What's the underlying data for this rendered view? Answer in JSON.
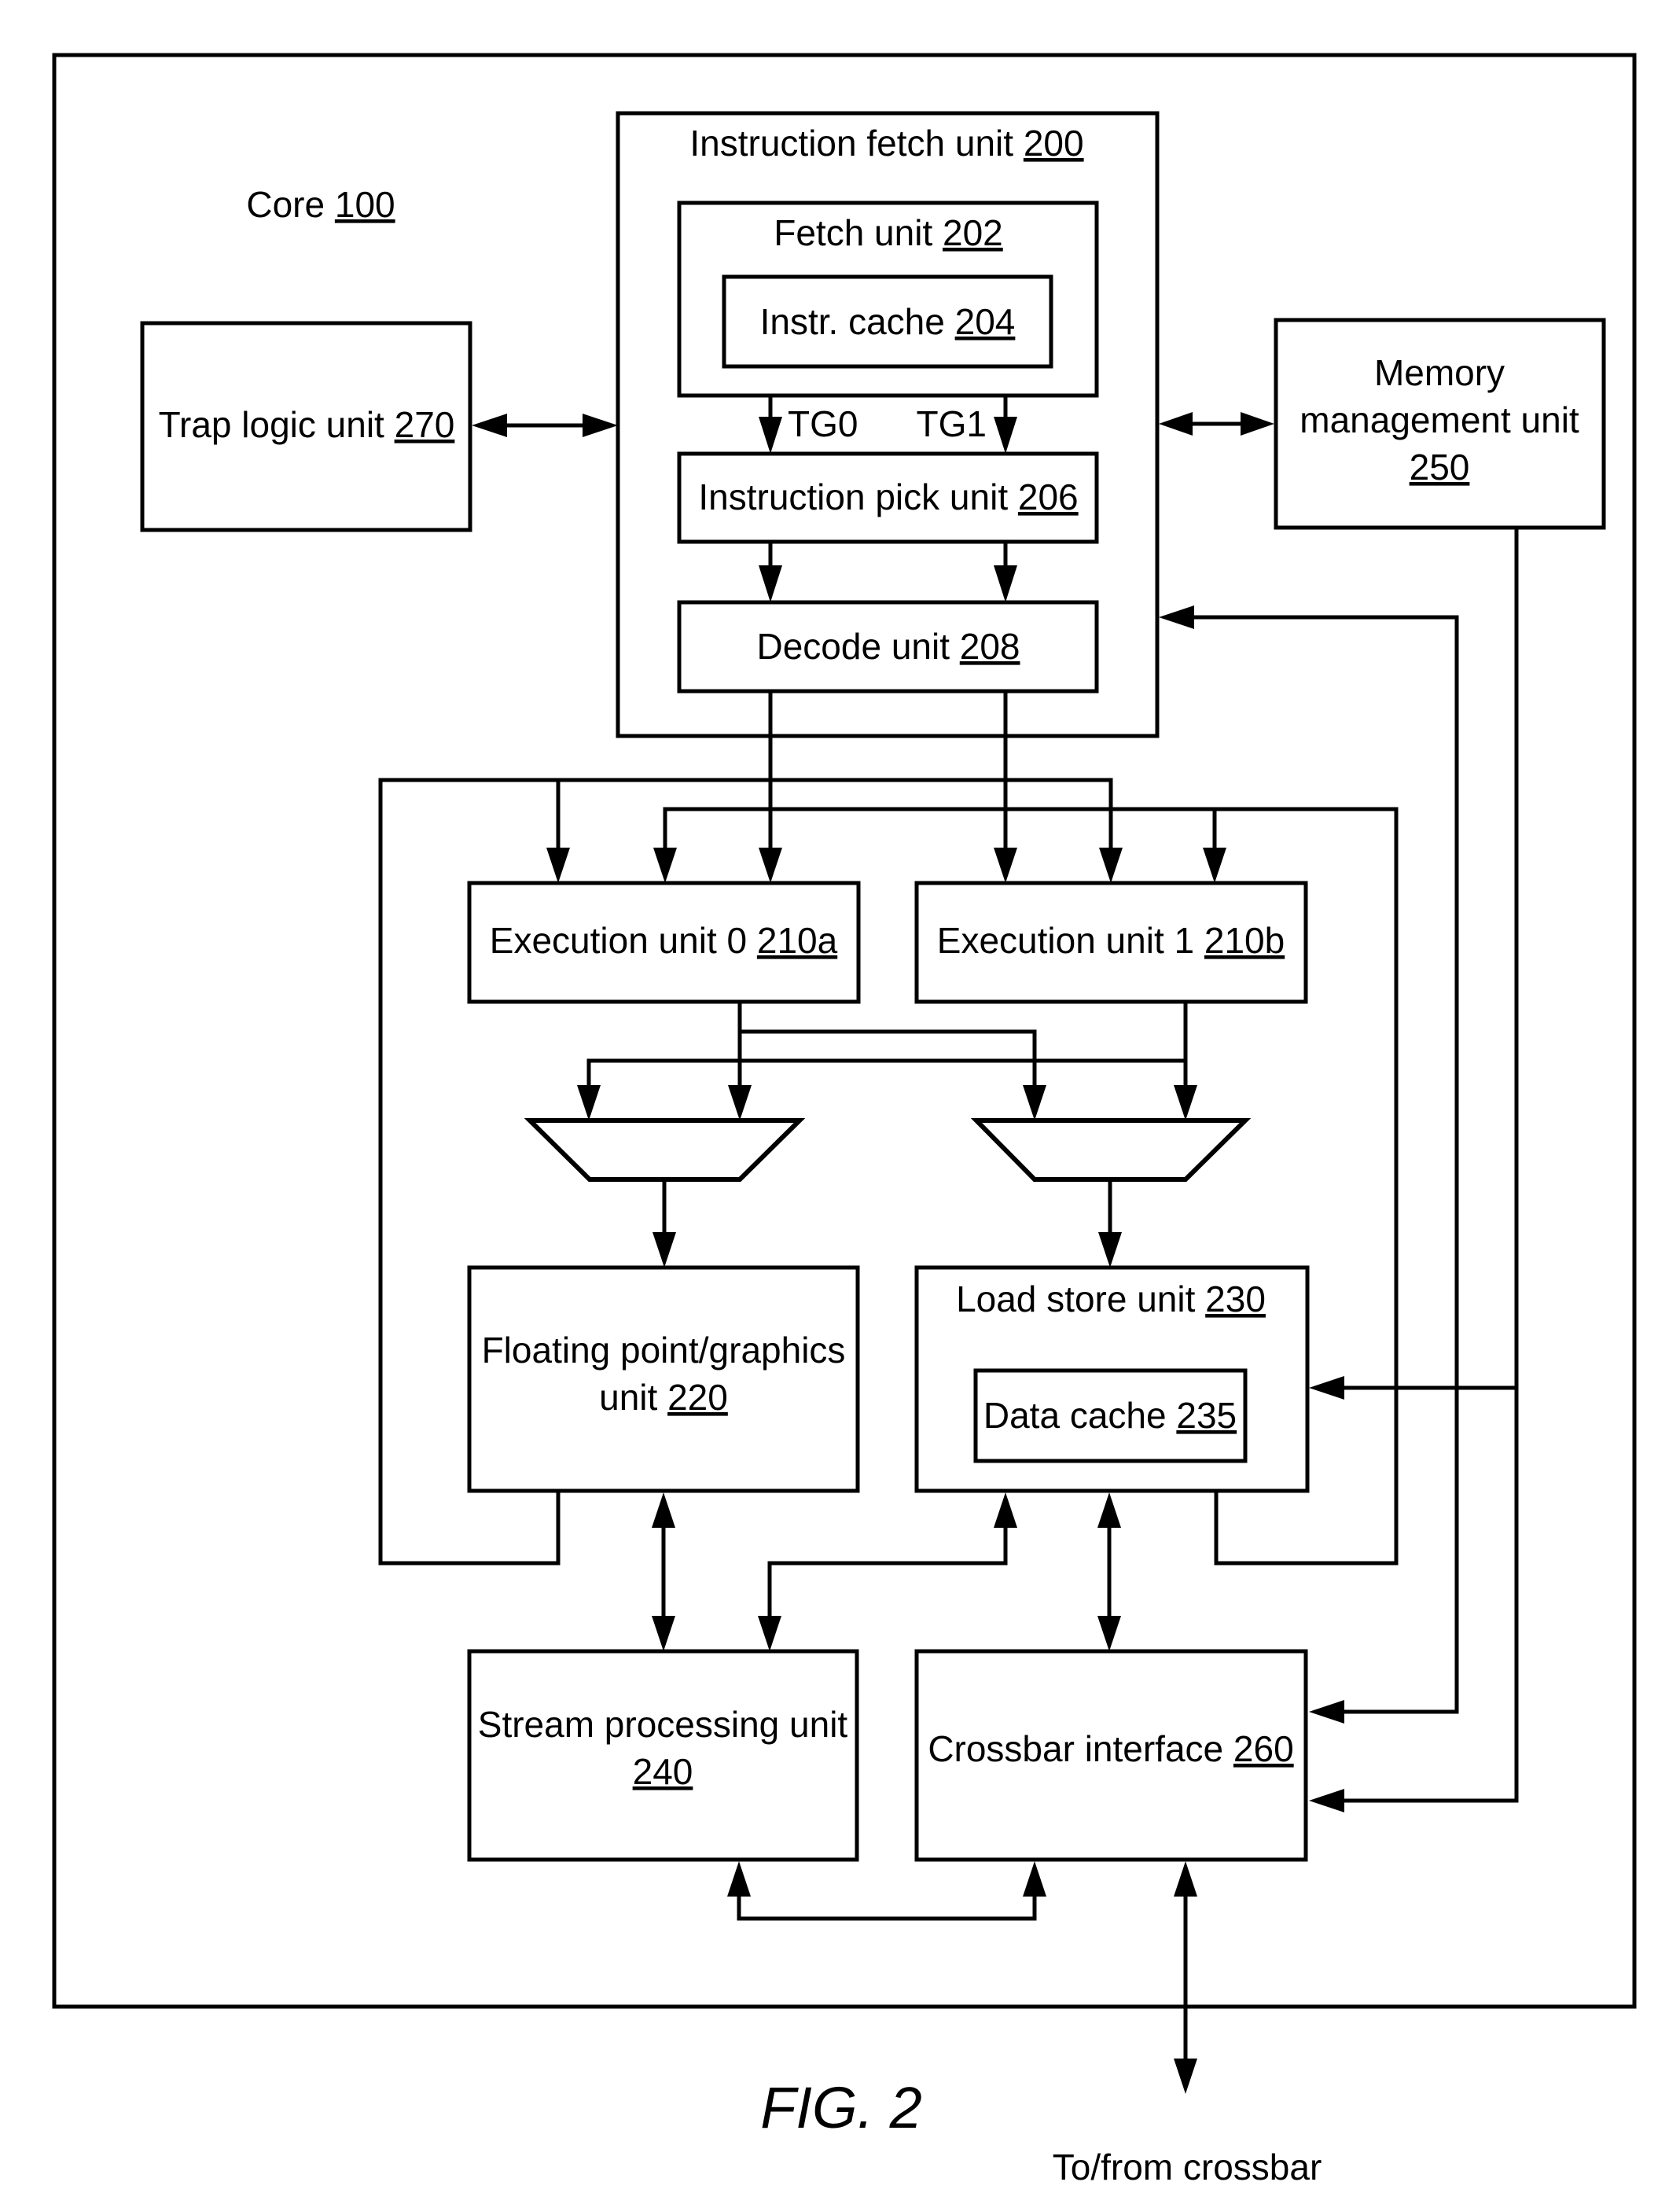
{
  "figure": {
    "caption": "FIG. 2",
    "external_label": "To/from crossbar"
  },
  "core": {
    "name": "Core",
    "ref": "100"
  },
  "blocks": {
    "ifu": {
      "name": "Instruction fetch unit",
      "ref": "200"
    },
    "fetch": {
      "name": "Fetch unit",
      "ref": "202"
    },
    "icache": {
      "name": "Instr. cache",
      "ref": "204"
    },
    "pick": {
      "name": "Instruction pick unit",
      "ref": "206"
    },
    "decode": {
      "name": "Decode unit",
      "ref": "208"
    },
    "eu0": {
      "name": "Execution unit 0",
      "ref": "210a"
    },
    "eu1": {
      "name": "Execution unit 1",
      "ref": "210b"
    },
    "fgu": {
      "name_line1": "Floating point/graphics",
      "name_line2": "unit",
      "ref": "220"
    },
    "lsu": {
      "name": "Load store unit",
      "ref": "230"
    },
    "dcache": {
      "name": "Data cache",
      "ref": "235"
    },
    "spu": {
      "name_line1": "Stream processing unit",
      "ref": "240"
    },
    "mmu": {
      "name_line1": "Memory",
      "name_line2": "management unit",
      "ref": "250"
    },
    "xbi": {
      "name": "Crossbar interface",
      "ref": "260"
    },
    "tlu": {
      "name": "Trap logic unit",
      "ref": "270"
    }
  },
  "thread_groups": {
    "tg0": "TG0",
    "tg1": "TG1"
  }
}
